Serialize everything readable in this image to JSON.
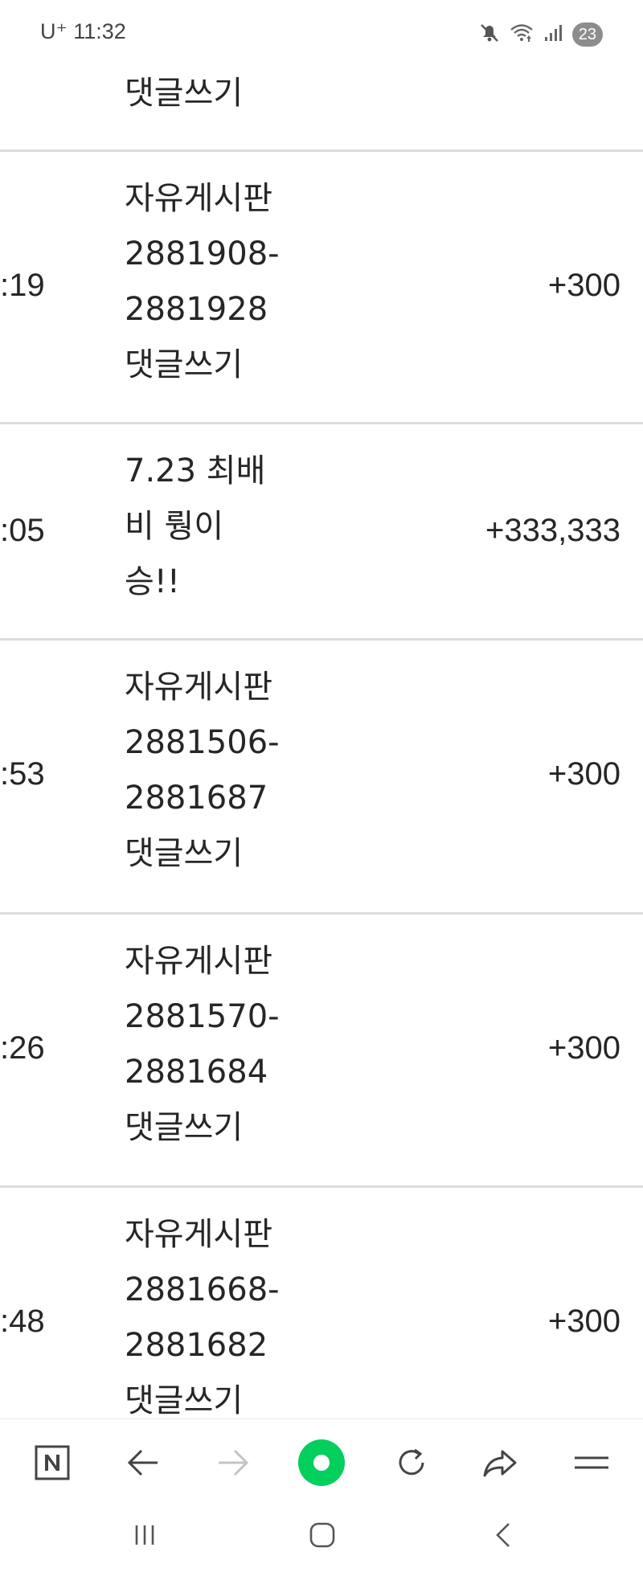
{
  "status_bar": {
    "carrier_time": "U⁺ 11:32",
    "notification_count": "23"
  },
  "rows": [
    {
      "time": "",
      "desc_lines": [
        "댓글쓰기"
      ],
      "amount": ""
    },
    {
      "time": ":19",
      "desc_lines": [
        "자유게시판",
        "2881908-",
        "2881928",
        "댓글쓰기"
      ],
      "amount": "+300"
    },
    {
      "time": ":05",
      "desc_lines": [
        "7.23 최배",
        "비 뤙이",
        "승!!"
      ],
      "amount": "+333,333"
    },
    {
      "time": ":53",
      "desc_lines": [
        "자유게시판",
        "2881506-",
        "2881687",
        "댓글쓰기"
      ],
      "amount": "+300"
    },
    {
      "time": ":26",
      "desc_lines": [
        "자유게시판",
        "2881570-",
        "2881684",
        "댓글쓰기"
      ],
      "amount": "+300"
    },
    {
      "time": ":48",
      "desc_lines": [
        "자유게시판",
        "2881668-",
        "2881682",
        "댓글쓰기"
      ],
      "amount": "+300"
    }
  ],
  "toolbar": {
    "icons": [
      "naver-n-icon",
      "back-arrow-icon",
      "forward-arrow-icon",
      "green-dot-icon",
      "refresh-icon",
      "share-icon",
      "menu-icon"
    ],
    "accent_color": "#03cf5d"
  },
  "system_nav": {
    "icons": [
      "recent-apps-icon",
      "home-icon",
      "system-back-icon"
    ]
  }
}
